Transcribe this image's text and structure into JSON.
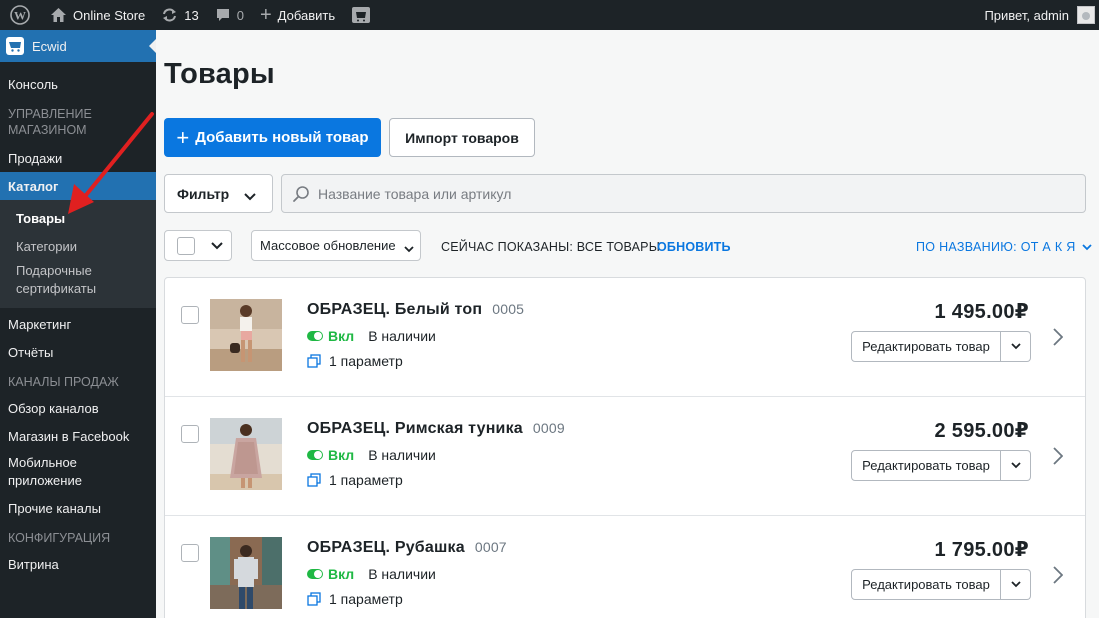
{
  "adminbar": {
    "site_name": "Online Store",
    "updates_count": "13",
    "comments_count": "0",
    "add_label": "Добавить",
    "greeting": "Привет, admin"
  },
  "sidebar": {
    "brand": "Ecwid",
    "items": [
      {
        "label": "Консоль"
      },
      {
        "section": "УПРАВЛЕНИЕ МАГАЗИНОМ"
      },
      {
        "label": "Продажи"
      },
      {
        "label": "Каталог"
      },
      {
        "label": "Товары"
      },
      {
        "label": "Категории"
      },
      {
        "label": "Подарочные сертификаты"
      },
      {
        "label": "Маркетинг"
      },
      {
        "label": "Отчёты"
      },
      {
        "section": "КАНАЛЫ ПРОДАЖ"
      },
      {
        "label": "Обзор каналов"
      },
      {
        "label": "Магазин в Facebook"
      },
      {
        "label": "Мобильное приложение"
      },
      {
        "label": "Прочие каналы"
      },
      {
        "section": "КОНФИГУРАЦИЯ"
      },
      {
        "label": "Витрина"
      }
    ]
  },
  "main": {
    "title": "Товары",
    "add_button": "Добавить новый товар",
    "import_button": "Импорт товаров",
    "filter_label": "Фильтр",
    "search_placeholder": "Название товара или артикул",
    "bulk_update_label": "Массовое обновление",
    "showing_label": "СЕЙЧАС ПОКАЗАНЫ: ВСЕ ТОВАРЫ",
    "refresh_label": "ОБНОВИТЬ",
    "sort_label": "ПО НАЗВАНИЮ: ОТ А К Я"
  },
  "products": [
    {
      "name": "ОБРАЗЕЦ. Белый топ",
      "sku": "0005",
      "status": "Вкл",
      "stock": "В наличии",
      "params": "1 параметр",
      "price": "1 495.00₽",
      "edit_label": "Редактировать товар"
    },
    {
      "name": "ОБРАЗЕЦ. Римская туника",
      "sku": "0009",
      "status": "Вкл",
      "stock": "В наличии",
      "params": "1 параметр",
      "price": "2 595.00₽",
      "edit_label": "Редактировать товар"
    },
    {
      "name": "ОБРАЗЕЦ. Рубашка",
      "sku": "0007",
      "status": "Вкл",
      "stock": "В наличии",
      "params": "1 параметр",
      "price": "1 795.00₽",
      "edit_label": "Редактировать товар"
    }
  ],
  "colors": {
    "primary_blue": "#0a77e0",
    "wp_blue": "#2271b1",
    "status_green": "#1fb844",
    "annotation_red": "#e02020"
  }
}
